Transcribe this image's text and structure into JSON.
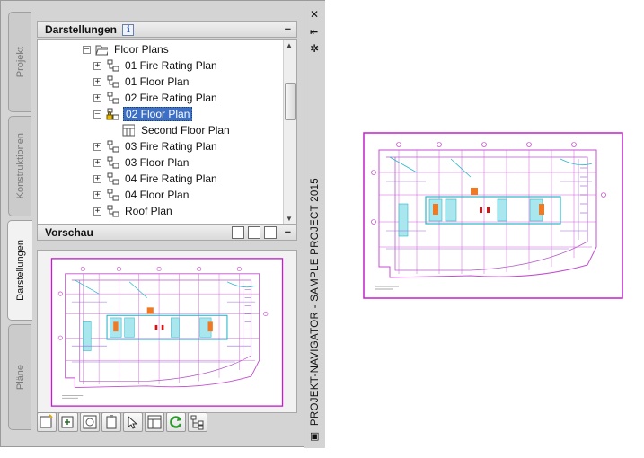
{
  "palette": {
    "title": "PROJEKT-NAVIGATOR - SAMPLE PROJECT 2015",
    "tabs": [
      {
        "label": "Projekt",
        "active": false
      },
      {
        "label": "Konstruktionen",
        "active": false
      },
      {
        "label": "Darstellungen",
        "active": true
      },
      {
        "label": "Pläne",
        "active": false
      }
    ],
    "strip_icons": [
      "close-icon",
      "auto-hide-icon",
      "properties-icon"
    ]
  },
  "views_panel": {
    "header": "Darstellungen",
    "collapse": "–",
    "info_glyph": "i",
    "tree": [
      {
        "label": "Floor Plans",
        "level": 0,
        "type": "folder",
        "expander": "–"
      },
      {
        "label": "01 Fire Rating Plan",
        "level": 1,
        "type": "view",
        "expander": "+"
      },
      {
        "label": "01 Floor Plan",
        "level": 1,
        "type": "view",
        "expander": "+"
      },
      {
        "label": "02 Fire Rating Plan",
        "level": 1,
        "type": "view",
        "expander": "+"
      },
      {
        "label": "02 Floor Plan",
        "level": 1,
        "type": "view-locked",
        "expander": "–",
        "selected": true
      },
      {
        "label": "Second Floor Plan",
        "level": 2,
        "type": "sheet",
        "expander": ""
      },
      {
        "label": "03 Fire Rating Plan",
        "level": 1,
        "type": "view",
        "expander": "+"
      },
      {
        "label": "03 Floor Plan",
        "level": 1,
        "type": "view",
        "expander": "+"
      },
      {
        "label": "04 Fire Rating Plan",
        "level": 1,
        "type": "view",
        "expander": "+"
      },
      {
        "label": "04 Floor Plan",
        "level": 1,
        "type": "view",
        "expander": "+"
      },
      {
        "label": "Roof Plan",
        "level": 1,
        "type": "view",
        "expander": "+"
      }
    ]
  },
  "preview_panel": {
    "header": "Vorschau",
    "collapse": "–",
    "tools": [
      "preview-mode-icon",
      "show-frame-icon",
      "zoom-preview-icon"
    ]
  },
  "bottom_toolbar": {
    "buttons": [
      "new-view-icon",
      "add-view-icon",
      "regenerate-icon",
      "clipboard-icon",
      "select-icon",
      "details-icon",
      "refresh-icon",
      "hierarchy-icon"
    ]
  },
  "colors": {
    "selection": "#3d6fc4",
    "drawing_magenta": "#d63adc",
    "drawing_cyan": "#2bb7c9",
    "drawing_orange": "#f07a24"
  }
}
